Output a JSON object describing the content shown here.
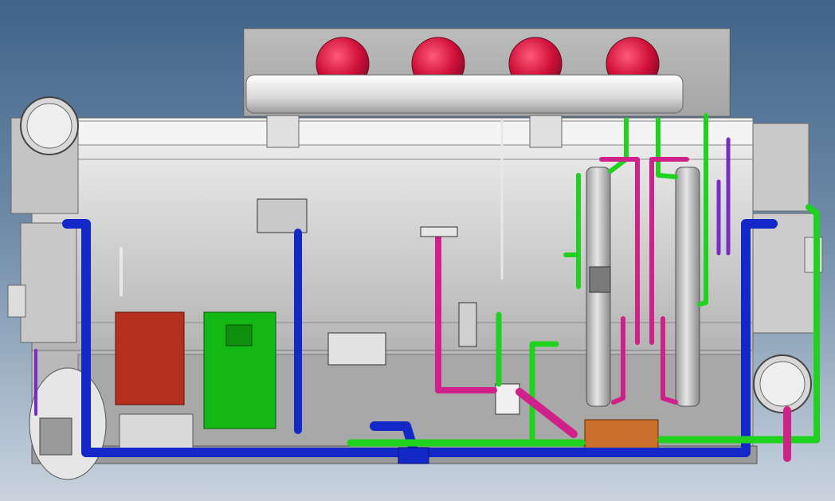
{
  "view": {
    "background_top": "#3f6489",
    "background_bottom": "#c9d3de"
  },
  "colors": {
    "machine_body": "#cfcfcf",
    "machine_shadow": "#9a9a9a",
    "dome": "#d0103a",
    "pipe_blue": "#1428c8",
    "pipe_green": "#1fd21f",
    "pipe_magenta": "#d0208a",
    "pipe_purple": "#7a2cc8",
    "panel_red": "#b5301c",
    "panel_green": "#14b814",
    "heat_block": "#c8702c"
  },
  "components": [
    "top-header-vessel",
    "red-dome-cap",
    "main-shell",
    "left-waterbox",
    "right-waterbox",
    "red-control-panel",
    "green-control-panel",
    "separator-column",
    "pump-assembly",
    "flanged-nozzle"
  ]
}
